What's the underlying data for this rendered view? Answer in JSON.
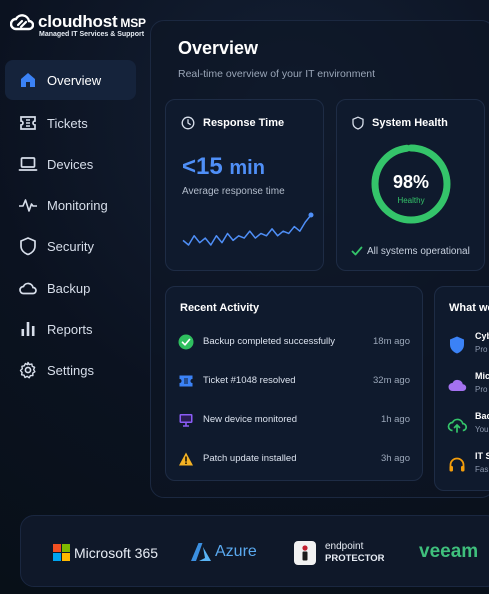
{
  "brand": {
    "name": "cloudhost",
    "suffix": "MSP",
    "tagline": "Managed IT Services & Support"
  },
  "sidebar": {
    "items": [
      {
        "label": "Overview",
        "icon": "home-icon",
        "active": true
      },
      {
        "label": "Tickets",
        "icon": "ticket-icon",
        "active": false
      },
      {
        "label": "Devices",
        "icon": "laptop-icon",
        "active": false
      },
      {
        "label": "Monitoring",
        "icon": "pulse-icon",
        "active": false
      },
      {
        "label": "Security",
        "icon": "shield-icon",
        "active": false
      },
      {
        "label": "Backup",
        "icon": "cloud-icon",
        "active": false
      },
      {
        "label": "Reports",
        "icon": "bar-chart-icon",
        "active": false
      },
      {
        "label": "Settings",
        "icon": "gear-icon",
        "active": false
      }
    ]
  },
  "page": {
    "title": "Overview",
    "subtitle": "Real-time overview of your IT environment"
  },
  "response_card": {
    "title": "Response Time",
    "value_prefix": "<15",
    "value_unit": "min",
    "subtitle": "Average response time",
    "trend": [
      4,
      2,
      6,
      3,
      5,
      2,
      6,
      3,
      7,
      4,
      6,
      5,
      8,
      5,
      7,
      6,
      9,
      6,
      8,
      7,
      10,
      8,
      12,
      15
    ]
  },
  "health_card": {
    "title": "System Health",
    "value": "98%",
    "percent": 98,
    "label": "Healthy",
    "status": "All systems operational"
  },
  "activity": {
    "title": "Recent Activity",
    "items": [
      {
        "text": "Backup completed successfully",
        "time": "18m ago",
        "icon": "check-circle-icon",
        "color": "#2fbf5f"
      },
      {
        "text": "Ticket #1048 resolved",
        "time": "32m ago",
        "icon": "ticket-icon",
        "color": "#3b82f6"
      },
      {
        "text": "New device monitored",
        "time": "1h ago",
        "icon": "monitor-icon",
        "color": "#8b5cf6"
      },
      {
        "text": "Patch update installed",
        "time": "3h ago",
        "icon": "warning-icon",
        "color": "#f5b324"
      }
    ]
  },
  "services": {
    "title": "What we",
    "items": [
      {
        "name": "Cyb",
        "desc": "Pro",
        "icon": "shield-icon",
        "color": "#3b82f6"
      },
      {
        "name": "Mic",
        "desc": "Pro",
        "icon": "cloud-icon",
        "color": "#a472f0"
      },
      {
        "name": "Bac",
        "desc": "You",
        "icon": "cloud-upload-icon",
        "color": "#34c46a"
      },
      {
        "name": "IT S",
        "desc": "Fas",
        "icon": "headset-icon",
        "color": "#f59e0b"
      }
    ]
  },
  "partners": [
    {
      "name": "Microsoft 365"
    },
    {
      "name": "Azure"
    },
    {
      "name": "endpoint",
      "name2": "PROTECTOR"
    },
    {
      "name": "veeam"
    }
  ],
  "colors": {
    "accent": "#4f8ff7",
    "healthy": "#34c46a",
    "background": "#0b1220"
  }
}
